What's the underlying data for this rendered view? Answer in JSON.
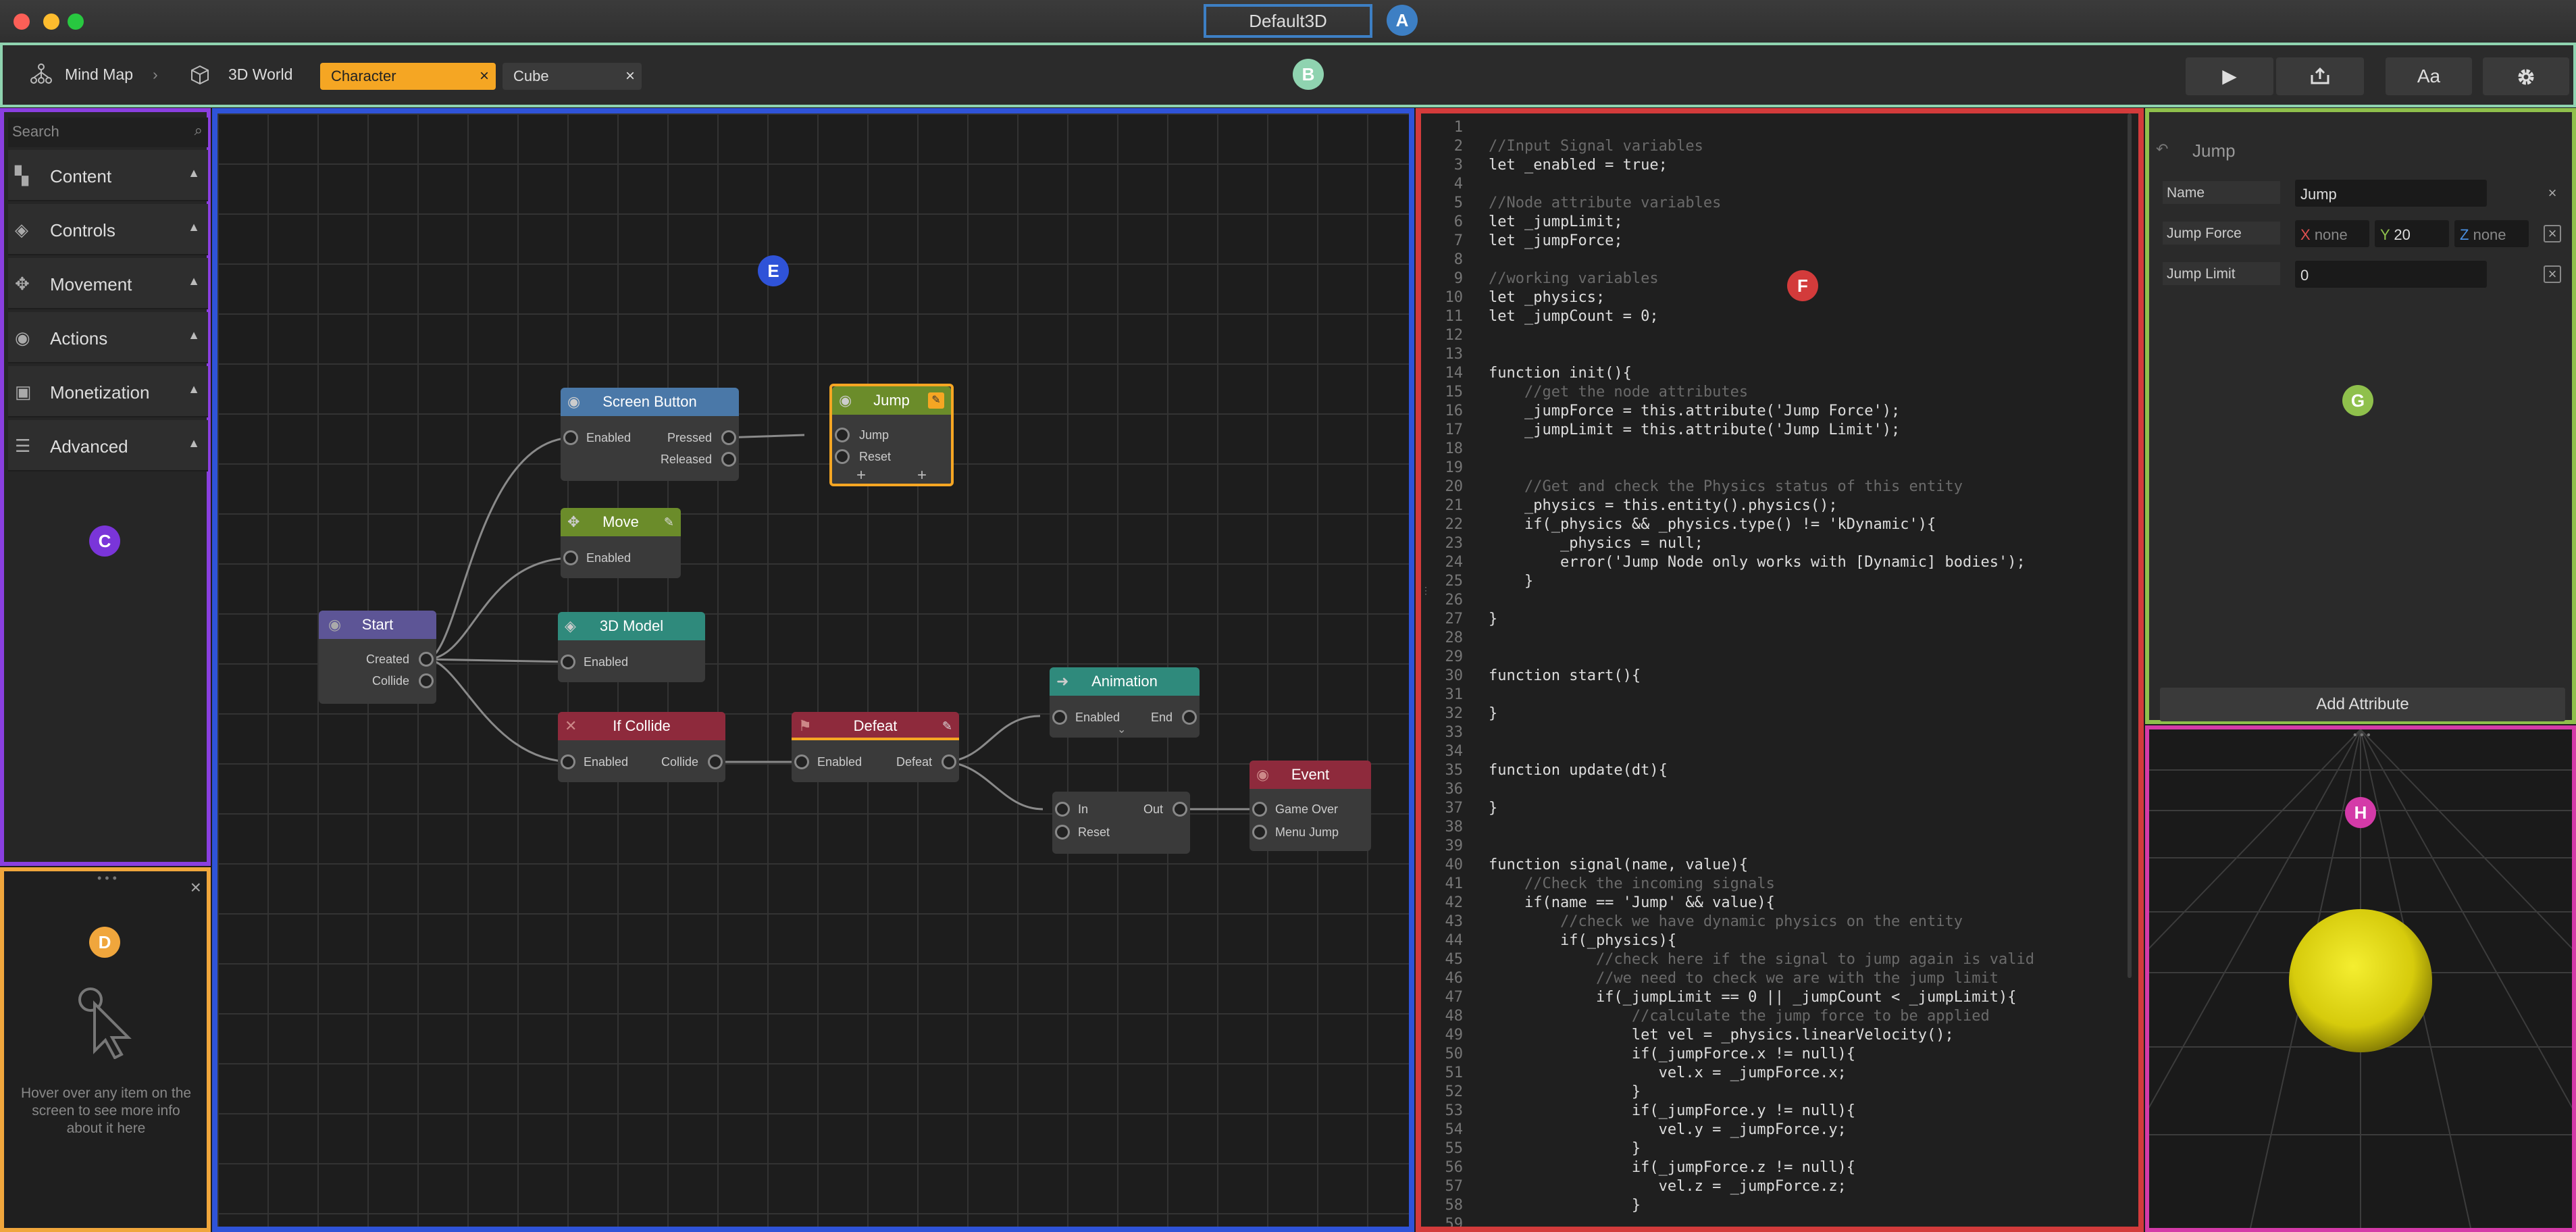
{
  "window": {
    "title": "Default3D"
  },
  "markers": {
    "a": "A",
    "b": "B",
    "c": "C",
    "d": "D",
    "e": "E",
    "f": "F",
    "g": "G",
    "h": "H"
  },
  "toolbar": {
    "mindmap": "Mind Map",
    "world": "3D World",
    "tab_active": "Character",
    "tab_inactive": "Cube",
    "font_btn": "Aa"
  },
  "sidebar": {
    "search_placeholder": "Search",
    "categories": [
      "Content",
      "Controls",
      "Movement",
      "Actions",
      "Monetization",
      "Advanced"
    ]
  },
  "help": {
    "text": "Hover over any item on the screen to see more info about it here"
  },
  "graph": {
    "screen_button": {
      "title": "Screen Button",
      "enabled": "Enabled",
      "pressed": "Pressed",
      "released": "Released"
    },
    "jump": {
      "title": "Jump",
      "jump": "Jump",
      "reset": "Reset"
    },
    "move": {
      "title": "Move",
      "enabled": "Enabled"
    },
    "start": {
      "title": "Start",
      "created": "Created",
      "collide": "Collide"
    },
    "model": {
      "title": "3D Model",
      "enabled": "Enabled"
    },
    "if_collide": {
      "title": "If Collide",
      "enabled": "Enabled",
      "collide": "Collide"
    },
    "defeat": {
      "title": "Defeat",
      "enabled": "Enabled",
      "defeat": "Defeat"
    },
    "animation": {
      "title": "Animation",
      "enabled": "Enabled",
      "end": "End"
    },
    "seq": {
      "in": "In",
      "reset": "Reset",
      "out": "Out"
    },
    "event": {
      "title": "Event",
      "game_over": "Game Over",
      "menu_jump": "Menu Jump"
    }
  },
  "code": {
    "lines": [
      "",
      "//Input Signal variables",
      "let _enabled = true;",
      "",
      "//Node attribute variables",
      "let _jumpLimit;",
      "let _jumpForce;",
      "",
      "//working variables",
      "let _physics;",
      "let _jumpCount = 0;",
      "",
      "",
      "function init(){",
      "    //get the node attributes",
      "    _jumpForce = this.attribute('Jump Force');",
      "    _jumpLimit = this.attribute('Jump Limit');",
      "",
      "",
      "    //Get and check the Physics status of this entity",
      "    _physics = this.entity().physics();",
      "    if(_physics && _physics.type() != 'kDynamic'){",
      "        _physics = null;",
      "        error('Jump Node only works with [Dynamic] bodies');",
      "    }",
      "",
      "}",
      "",
      "",
      "function start(){",
      "",
      "}",
      "",
      "",
      "function update(dt){",
      "",
      "}",
      "",
      "",
      "function signal(name, value){",
      "    //Check the incoming signals",
      "    if(name == 'Jump' && value){",
      "        //check we have dynamic physics on the entity",
      "        if(_physics){",
      "            //check here if the signal to jump again is valid",
      "            //we need to check we are with the jump limit",
      "            if(_jumpLimit == 0 || _jumpCount < _jumpLimit){",
      "                //calculate the jump force to be applied",
      "                let vel = _physics.linearVelocity();",
      "                if(_jumpForce.x != null){",
      "                   vel.x = _jumpForce.x;",
      "                }",
      "                if(_jumpForce.y != null){",
      "                   vel.y = _jumpForce.y;",
      "                }",
      "                if(_jumpForce.z != null){",
      "                   vel.z = _jumpForce.z;",
      "                }",
      ""
    ]
  },
  "attributes": {
    "header": "Jump",
    "name_label": "Name",
    "name_value": "Jump",
    "force_label": "Jump Force",
    "x_label": "X",
    "x_value": "none",
    "y_label": "Y",
    "y_value": "20",
    "z_label": "Z",
    "z_value": "none",
    "limit_label": "Jump Limit",
    "limit_value": "0",
    "add_button": "Add Attribute"
  },
  "colors": {
    "accent_orange": "#f5a623",
    "node_blue": "#4a78a8",
    "node_green": "#6b8c2a",
    "node_purple": "#5d5596",
    "node_teal": "#2f8a7c",
    "node_red": "#8e2a3c",
    "sphere": "#e6dd10"
  }
}
